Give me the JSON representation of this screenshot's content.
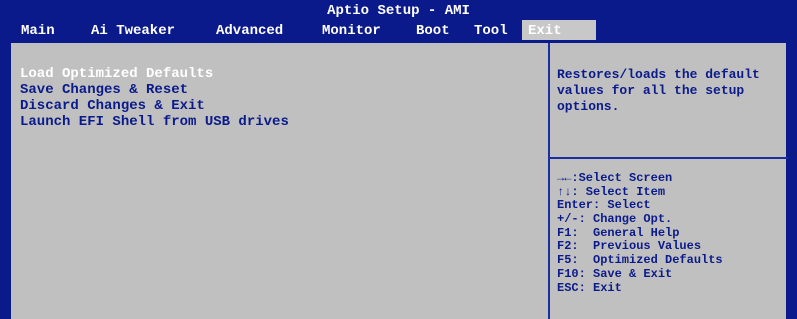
{
  "window": {
    "title": "Aptio Setup - AMI"
  },
  "tabs": [
    {
      "label": "Main",
      "active": false
    },
    {
      "label": "Ai Tweaker",
      "active": false
    },
    {
      "label": "Advanced",
      "active": false
    },
    {
      "label": "Monitor",
      "active": false
    },
    {
      "label": "Boot",
      "active": false
    },
    {
      "label": "Tool",
      "active": false
    },
    {
      "label": "Exit",
      "active": true
    }
  ],
  "menu": {
    "items": [
      {
        "label": "Load Optimized Defaults",
        "selected": true
      },
      {
        "label": "Save Changes & Reset",
        "selected": false
      },
      {
        "label": "Discard Changes & Exit",
        "selected": false
      },
      {
        "label": "Launch EFI Shell from USB drives",
        "selected": false
      }
    ]
  },
  "help": {
    "text": "Restores/loads the default values for all the setup options."
  },
  "keys": [
    {
      "icon": "left-right-arrows-icon",
      "text": "→←:Select Screen"
    },
    {
      "icon": "up-down-arrows-icon",
      "text": "↑↓: Select Item"
    },
    {
      "text": "Enter: Select"
    },
    {
      "text": "+/-: Change Opt."
    },
    {
      "text": "F1:  General Help"
    },
    {
      "text": "F2:  Previous Values"
    },
    {
      "text": "F5:  Optimized Defaults"
    },
    {
      "text": "F10: Save & Exit"
    },
    {
      "text": "ESC: Exit"
    }
  ],
  "colors": {
    "background": "#0a1a8a",
    "panel": "#c0c0c0",
    "active_tab": "#c8c8c8",
    "text_dark": "#0a1a8a",
    "text_light": "#ffffff"
  }
}
